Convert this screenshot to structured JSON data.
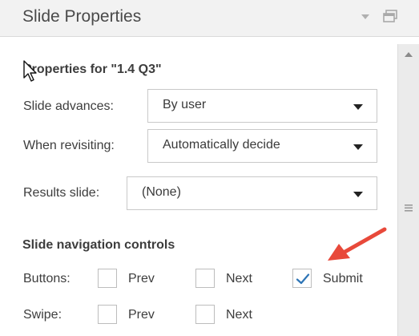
{
  "panel": {
    "title": "Slide Properties",
    "icons": {
      "dropdown": "chevron-down-icon",
      "window": "restore-window-icon"
    }
  },
  "properties": {
    "heading": "Properties for \"1.4 Q3\""
  },
  "fields": {
    "slide_advances": {
      "label": "Slide advances:",
      "value": "By user"
    },
    "when_revisiting": {
      "label": "When revisiting:",
      "value": "Automatically decide"
    },
    "results_slide": {
      "label": "Results slide:",
      "value": "(None)"
    }
  },
  "navigation": {
    "title": "Slide navigation controls",
    "buttons": {
      "label": "Buttons:",
      "options": [
        {
          "label": "Prev",
          "checked": false
        },
        {
          "label": "Next",
          "checked": false
        },
        {
          "label": "Submit",
          "checked": true
        }
      ]
    },
    "swipe": {
      "label": "Swipe:",
      "options": [
        {
          "label": "Prev",
          "checked": false
        },
        {
          "label": "Next",
          "checked": false
        }
      ]
    }
  },
  "colors": {
    "accent": "#2e75b6",
    "annotation_arrow": "#e8493a",
    "header_bg": "#f2f2f2"
  }
}
